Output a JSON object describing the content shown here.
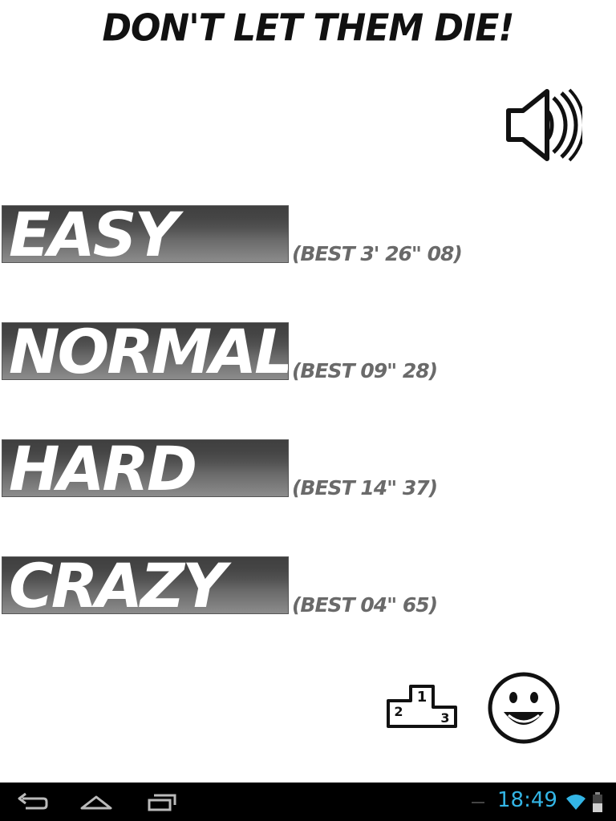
{
  "title": "DON'T LET THEM DIE!",
  "sound": {
    "icon": "speaker-icon",
    "state": "on"
  },
  "difficulties": [
    {
      "label": "EASY",
      "best": "(BEST 3' 26\" 08)"
    },
    {
      "label": "NORMAL",
      "best": "(BEST 09\" 28)"
    },
    {
      "label": "HARD",
      "best": "(BEST 14\" 37)"
    },
    {
      "label": "CRAZY",
      "best": "(BEST 04\" 65)"
    }
  ],
  "footer_buttons": {
    "leaderboard_icon": "podium-icon",
    "podium_numbers": [
      "1",
      "2",
      "3"
    ],
    "about_icon": "smiley-icon"
  },
  "system_bar": {
    "time": "18:49",
    "icons": [
      "back-icon",
      "home-icon",
      "recent-apps-icon",
      "wifi-icon",
      "battery-icon"
    ],
    "clock_color": "#33b5e5"
  },
  "colors": {
    "background": "#ffffff",
    "button_dark": "#2a2a2a",
    "button_light": "#8c8c8c",
    "best_text": "#6a6a6a",
    "navbar": "#000000"
  }
}
